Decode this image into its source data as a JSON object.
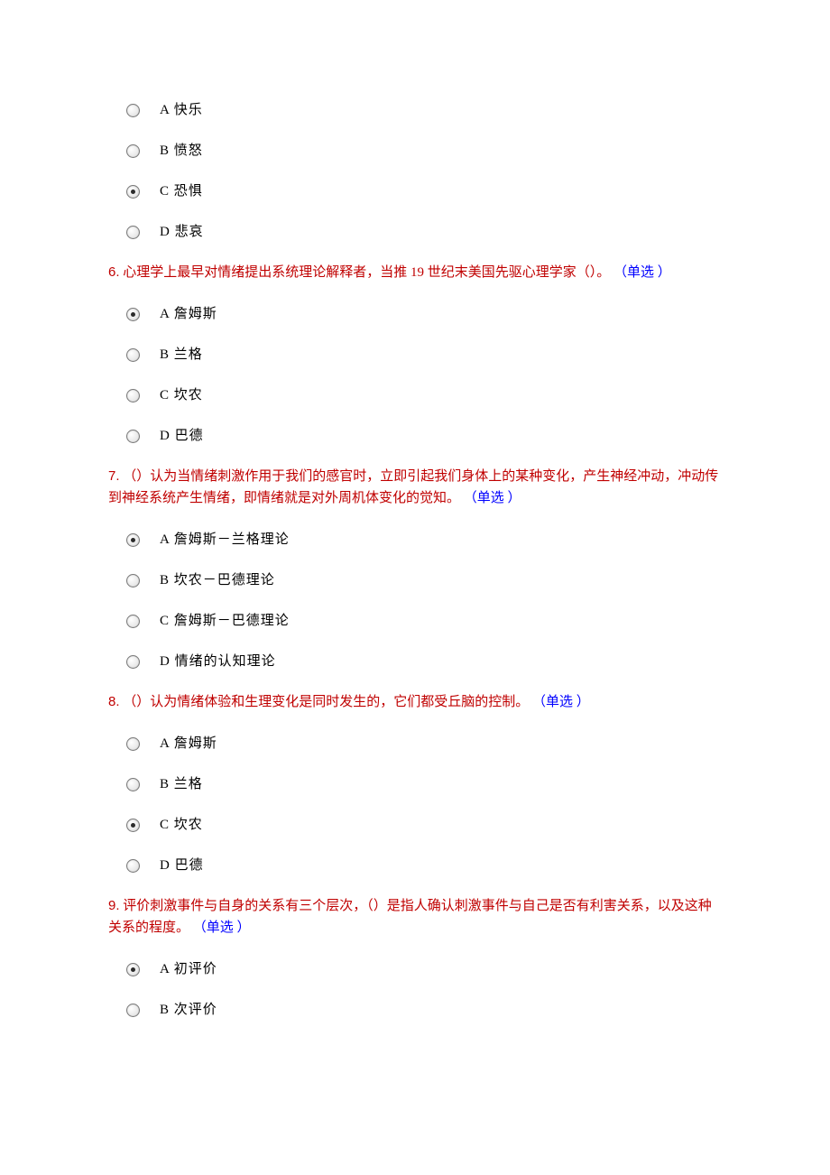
{
  "pre_options": {
    "items": [
      {
        "label": "A 快乐",
        "selected": false
      },
      {
        "label": "B 愤怒",
        "selected": false
      },
      {
        "label": "C 恐惧",
        "selected": true
      },
      {
        "label": "D 悲哀",
        "selected": false
      }
    ]
  },
  "questions": [
    {
      "num": "6.",
      "body": "心理学上最早对情绪提出系统理论解释者，当推 19 世纪末美国先驱心理学家（）。",
      "type": "（单选 ）",
      "options": [
        {
          "label": "A 詹姆斯",
          "selected": true
        },
        {
          "label": "B 兰格",
          "selected": false
        },
        {
          "label": "C 坎农",
          "selected": false
        },
        {
          "label": "D 巴德",
          "selected": false
        }
      ]
    },
    {
      "num": "7.",
      "body": "（）认为当情绪刺激作用于我们的感官时，立即引起我们身体上的某种变化，产生神经冲动，冲动传到神经系统产生情绪，即情绪就是对外周机体变化的觉知。",
      "type": "（单选 ）",
      "options": [
        {
          "label": "A 詹姆斯－兰格理论",
          "selected": true
        },
        {
          "label": "B 坎农－巴德理论",
          "selected": false
        },
        {
          "label": "C 詹姆斯－巴德理论",
          "selected": false
        },
        {
          "label": "D 情绪的认知理论",
          "selected": false
        }
      ]
    },
    {
      "num": "8.",
      "body": "（）认为情绪体验和生理变化是同时发生的，它们都受丘脑的控制。",
      "type": "（单选 ）",
      "options": [
        {
          "label": "A 詹姆斯",
          "selected": false
        },
        {
          "label": "B 兰格",
          "selected": false
        },
        {
          "label": "C 坎农",
          "selected": true
        },
        {
          "label": "D 巴德",
          "selected": false
        }
      ]
    },
    {
      "num": "9.",
      "body": "评价刺激事件与自身的关系有三个层次，（）是指人确认刺激事件与自己是否有利害关系，以及这种关系的程度。",
      "type": "（单选 ）",
      "options": [
        {
          "label": "A 初评价",
          "selected": true
        },
        {
          "label": "B 次评价",
          "selected": false
        }
      ]
    }
  ]
}
